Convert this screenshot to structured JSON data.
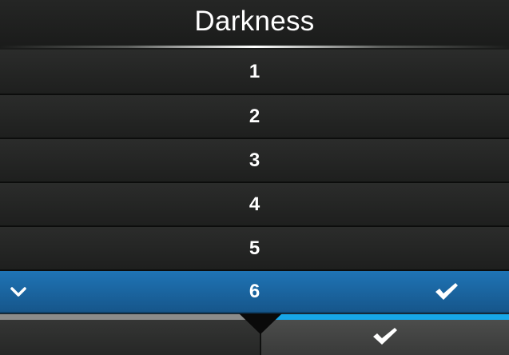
{
  "header": {
    "title": "Darkness"
  },
  "list": {
    "items": [
      {
        "label": "1",
        "selected": false
      },
      {
        "label": "2",
        "selected": false
      },
      {
        "label": "3",
        "selected": false
      },
      {
        "label": "4",
        "selected": false
      },
      {
        "label": "5",
        "selected": false
      },
      {
        "label": "6",
        "selected": true
      }
    ],
    "selected_value": "6",
    "selected_left_icon": "chevron-down-icon",
    "selected_right_icon": "check-icon"
  },
  "footer": {
    "back_button_icon": "none",
    "ok_button_icon": "check-icon"
  },
  "colors": {
    "background": "#1b1c1b",
    "selected_row": "#1f74b5",
    "ok_accent": "#17a7e8",
    "back_accent": "#8b8c8b",
    "text": "#ffffff"
  }
}
